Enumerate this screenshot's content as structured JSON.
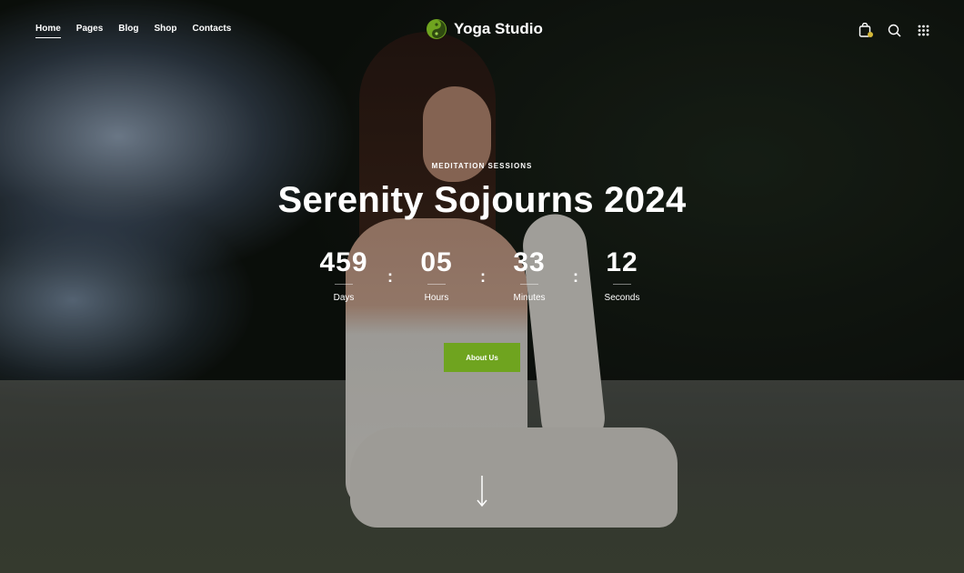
{
  "nav": {
    "items": [
      {
        "label": "Home",
        "active": true
      },
      {
        "label": "Pages",
        "active": false
      },
      {
        "label": "Blog",
        "active": false
      },
      {
        "label": "Shop",
        "active": false
      },
      {
        "label": "Contacts",
        "active": false
      }
    ]
  },
  "brand": {
    "name": "Yoga Studio",
    "logo_icon": "yin-yang-icon",
    "accent_color": "#6fa41f"
  },
  "tools": {
    "icons": [
      "cart-icon",
      "search-icon",
      "grid-menu-icon"
    ],
    "cart_badge_color": "#d4b838"
  },
  "hero": {
    "eyebrow": "MEDITATION SESSIONS",
    "title": "Serenity Sojourns 2024",
    "countdown": [
      {
        "value": "459",
        "label": "Days"
      },
      {
        "value": "05",
        "label": "Hours"
      },
      {
        "value": "33",
        "label": "Minutes"
      },
      {
        "value": "12",
        "label": "Seconds"
      }
    ],
    "separator": ":",
    "cta_label": "About Us",
    "scroll_icon": "arrow-down-icon"
  }
}
